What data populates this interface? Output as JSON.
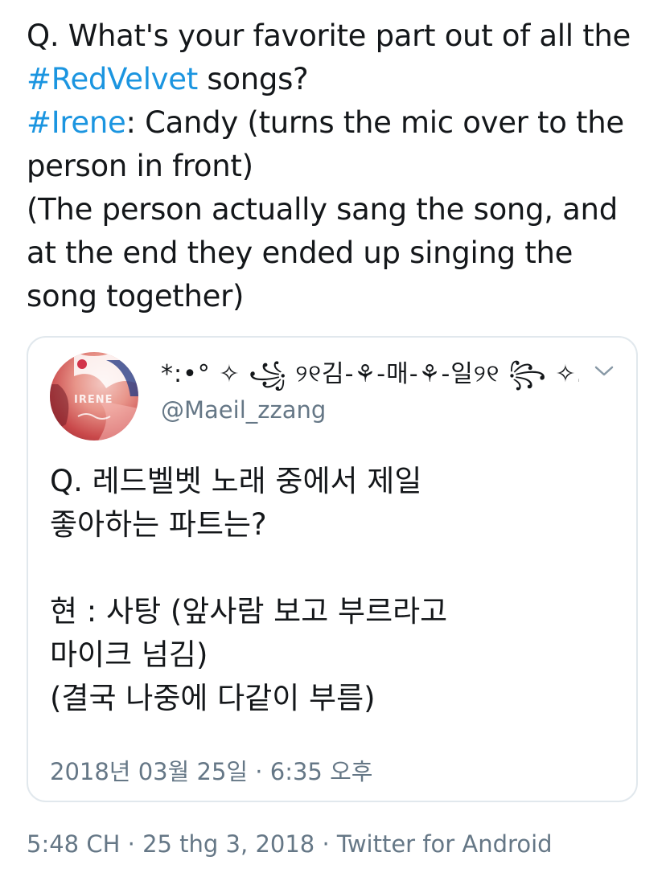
{
  "tweet": {
    "lines": [
      {
        "segments": [
          {
            "text": "Q. What's your favorite part out of all the",
            "type": "text"
          }
        ]
      },
      {
        "segments": [
          {
            "text": "#RedVelvet",
            "type": "hashtag"
          },
          {
            "text": " songs?",
            "type": "text"
          }
        ]
      },
      {
        "segments": [
          {
            "text": "#Irene",
            "type": "hashtag"
          },
          {
            "text": ": Candy (turns the mic over to the",
            "type": "text"
          }
        ]
      },
      {
        "segments": [
          {
            "text": "person in front)",
            "type": "text"
          }
        ]
      },
      {
        "segments": [
          {
            "text": "(The person actually sang the song, and",
            "type": "text"
          }
        ]
      },
      {
        "segments": [
          {
            "text": "at the end they ended up singing the",
            "type": "text"
          }
        ]
      },
      {
        "segments": [
          {
            "text": "song together)",
            "type": "text"
          }
        ]
      }
    ],
    "meta": {
      "time": "5:48 CH",
      "date": "25 thg 3, 2018",
      "separator": " · ",
      "source": "Twitter for Android"
    }
  },
  "quote": {
    "avatar_icon": "profile-photo",
    "avatar_text": "IRENE",
    "display_name": "*:•° ✧ ꧁ ୨୧김-⚘-매-⚘-일୨୧ ꧂ ✧...",
    "handle": "@Maeil_zzang",
    "chevron_icon": "chevron-down-icon",
    "body_lines": [
      "Q. 레드벨벳 노래 중에서 제일",
      "좋아하는 파트는?",
      "",
      "현 : 사탕 (앞사람 보고 부르라고",
      "마이크 넘김)",
      "(결국 나중에 다같이 부름)"
    ],
    "meta": "2018년 03월 25일 · 6:35 오후"
  },
  "colors": {
    "hashtag": "#1b95e0",
    "text": "#14171a",
    "secondary": "#657786",
    "border": "#e1e8ed"
  }
}
